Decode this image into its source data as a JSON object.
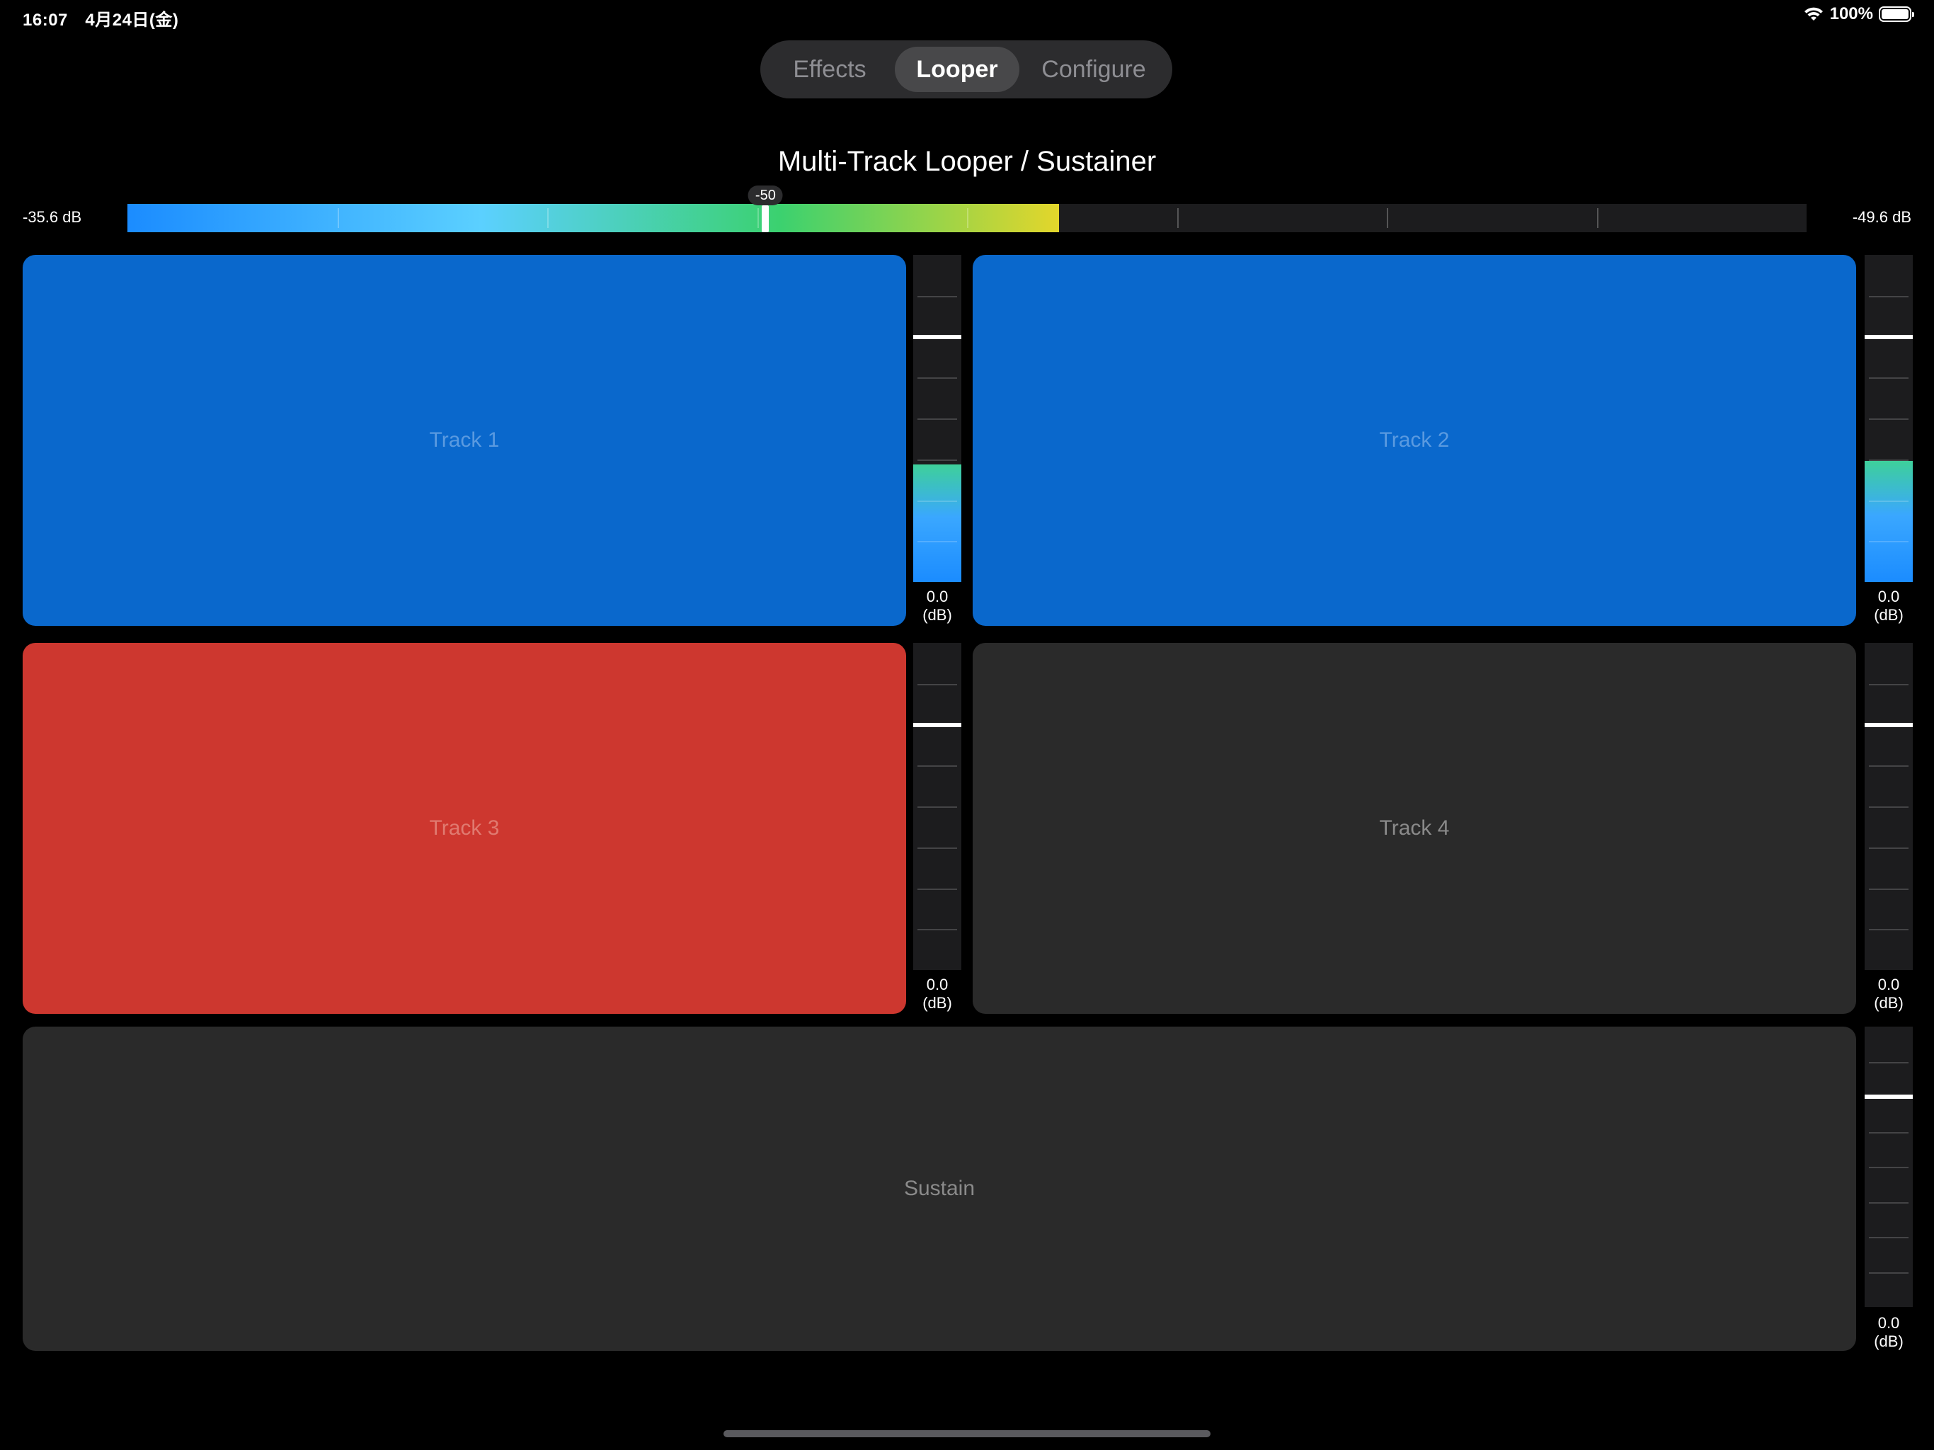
{
  "status_bar": {
    "time_date": "16:07　4月24日(金)",
    "battery": "100%"
  },
  "segmented": {
    "tabs": [
      "Effects",
      "Looper",
      "Configure"
    ],
    "active": "Looper"
  },
  "title": "Multi-Track Looper / Sustainer",
  "top_meter": {
    "left_label": "-35.6 dB",
    "right_label": "-49.6 dB",
    "level": 0.555,
    "thumb_value": "-50",
    "thumb_fraction": 0.38,
    "colors": [
      "#1b8cff",
      "#5bd0ff",
      "#3bd16f",
      "#e3d62b"
    ]
  },
  "tracks": [
    {
      "label": "Track 1",
      "color": "#0a68cc",
      "label_color": "#5a9ae0",
      "db_value": "0.0",
      "db_unit": "(dB)",
      "level": 0.36
    },
    {
      "label": "Track 2",
      "color": "#0a68cc",
      "label_color": "#5a9ae0",
      "db_value": "0.0",
      "db_unit": "(dB)",
      "level": 0.37
    },
    {
      "label": "Track 3",
      "color": "#cd372f",
      "label_color": "#e07a70",
      "db_value": "0.0",
      "db_unit": "(dB)",
      "level": 0
    },
    {
      "label": "Track 4",
      "color": "#2a2a2a",
      "label_color": "#8a8a8a",
      "db_value": "0.0",
      "db_unit": "(dB)",
      "level": 0
    }
  ],
  "sustain": {
    "label": "Sustain",
    "color": "#2a2a2a",
    "label_color": "#8a8a8a",
    "db_value": "0.0",
    "db_unit": "(dB)",
    "level": 0
  }
}
